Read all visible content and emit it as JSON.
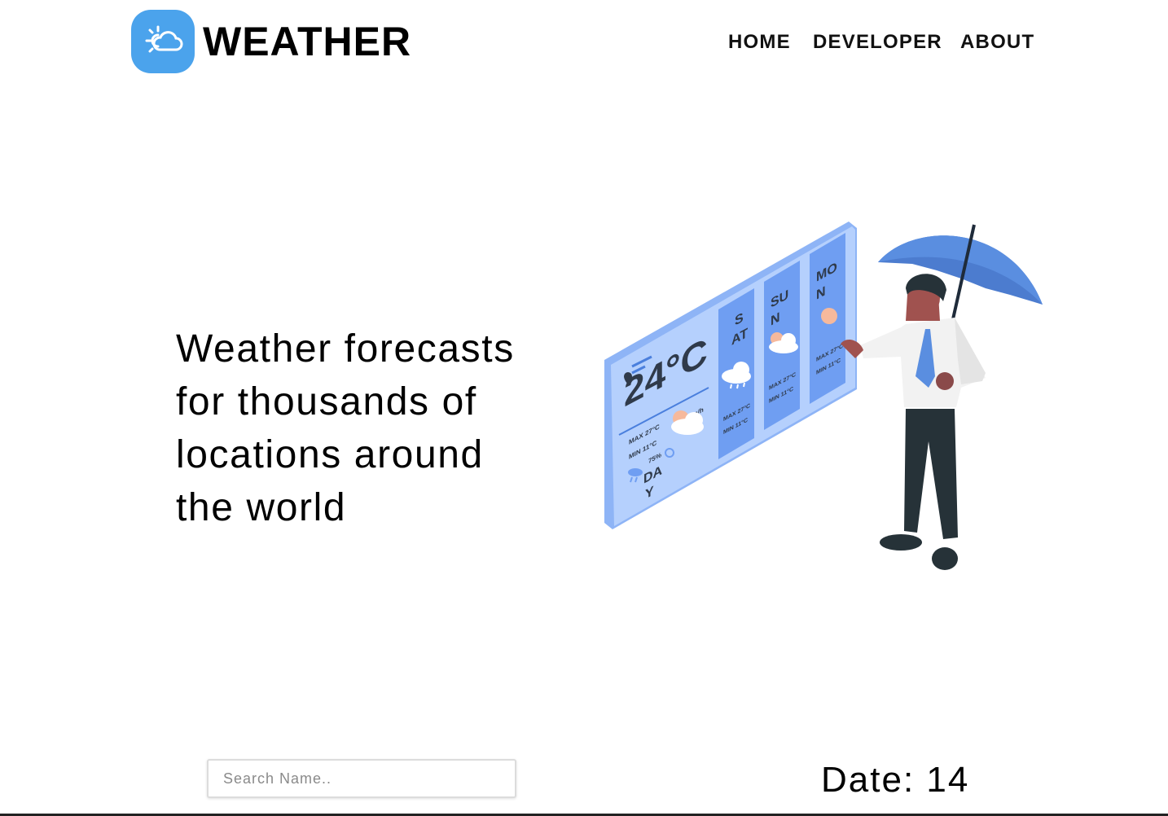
{
  "brand": {
    "name": "WEATHER",
    "icon": "sun-cloud-icon",
    "badge_color": "#4ba3ec"
  },
  "nav": {
    "items": [
      "HOME",
      "DEVELOPER",
      "ABOUT"
    ]
  },
  "hero": {
    "lines": [
      "Weather forecasts",
      "for thousands of",
      "locations around",
      "the world"
    ]
  },
  "illustration": {
    "temperature": "24°C",
    "day_label": [
      "DA",
      "Y"
    ],
    "today": {
      "max": "MAX 27°C",
      "min": "MIN 11°C",
      "humidity": "75%",
      "wind": "15 km/h"
    },
    "columns": [
      {
        "day": [
          "S",
          "AT"
        ],
        "max": "MAX 27°C",
        "min": "MIN 11°C",
        "icon": "rain-cloud-icon"
      },
      {
        "day": [
          "SU",
          "N"
        ],
        "max": "MAX 27°C",
        "min": "MIN 11°C",
        "icon": "sun-cloud-icon"
      },
      {
        "day": [
          "MO",
          "N"
        ],
        "max": "MAX 27°C",
        "min": "MIN 11°C",
        "icon": "sun-icon"
      }
    ]
  },
  "search": {
    "placeholder": "Search Name..",
    "value": ""
  },
  "date": {
    "label": "Date:",
    "value": "14"
  },
  "colors": {
    "panel": "#a9c8fb",
    "panel_dark": "#6f9ef2",
    "umbrella": "#4c7ccf",
    "text": "#2f3a4a"
  }
}
